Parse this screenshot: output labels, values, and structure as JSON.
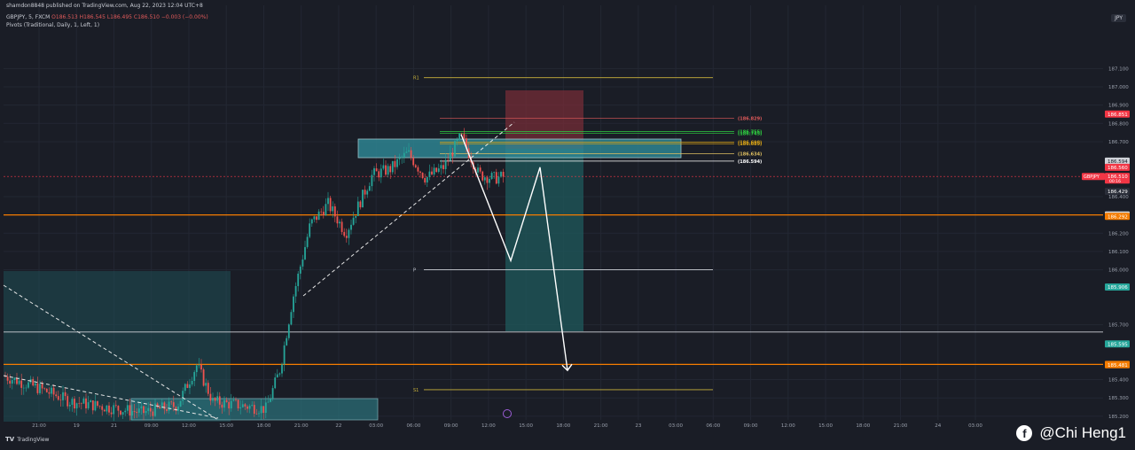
{
  "header": {
    "publisher_line": "shamdon8848 published on TradingView.com, Aug 22, 2023 12:04 UTC+8",
    "symbol_line": "GBPJPY, 5, FXCM",
    "ohlc_line": "O186.513 H186.545 L186.495 C186.510 −0.003 (−0.00%)",
    "indicator_line": "Pivots (Traditional, Daily, 1, Left, 1)",
    "currency_badge": "JPY"
  },
  "footer": {
    "brand": "TradingView",
    "logo": "TV"
  },
  "watermark": {
    "icon": "facebook-icon",
    "text": "@Chi Heng1"
  },
  "colors": {
    "background": "#1a1d26",
    "bull": "#26a69a",
    "bear": "#ef5350",
    "zone": "#1f4e55",
    "orange_line": "#f57c00",
    "pivot_yellow": "#c9b23a",
    "pivot_white": "#cfd2d8",
    "current_price": "#f23645"
  },
  "chart_data": {
    "type": "candlestick",
    "symbol": "GBPJPY",
    "timeframe": "5",
    "ylim": [
      185.18,
      187.3
    ],
    "price_axis_ticks": [
      187.1,
      187.0,
      186.9,
      186.8,
      186.7,
      186.4,
      186.2,
      186.1,
      186.0,
      185.7,
      185.4,
      185.3,
      185.2
    ],
    "price_labels": [
      {
        "value": 186.851,
        "text": "186.851",
        "color": "#f23645"
      },
      {
        "value": 186.594,
        "text": "186.594",
        "color": "#cfd2d8"
      },
      {
        "value": 186.56,
        "text": "186.560",
        "color": "#f23645"
      },
      {
        "value": 186.51,
        "text": "186.510",
        "color": "#f23645"
      },
      {
        "value": 186.429,
        "text": "186.429",
        "color": "#2a2e39"
      },
      {
        "value": 186.3,
        "text": "186.300",
        "color": "#cfd2d8"
      },
      {
        "value": 186.292,
        "text": "186.292",
        "color": "#f57c00"
      },
      {
        "value": 185.906,
        "text": "185.906",
        "color": "#26a69a"
      },
      {
        "value": 185.595,
        "text": "185.595",
        "color": "#26a69a"
      },
      {
        "value": 185.483,
        "text": "185.483",
        "color": "#f57c00"
      },
      {
        "value": 185.481,
        "text": "185.481",
        "color": "#f57c00"
      }
    ],
    "current_price_label": {
      "symbol": "GBPJPY",
      "price": "186.510",
      "countdown": "00:16"
    },
    "time_axis_ticks": [
      "21:00",
      "19",
      "21",
      "09:00",
      "12:00",
      "15:00",
      "18:00",
      "21:00",
      "22",
      "03:00",
      "06:00",
      "09:00",
      "12:00",
      "15:00",
      "18:00",
      "21:00",
      "23",
      "03:00",
      "06:00",
      "09:00",
      "12:00",
      "15:00",
      "18:00",
      "21:00",
      "24",
      "03:00"
    ],
    "pivots": [
      {
        "name": "R1",
        "value": 187.05,
        "color": "#c9b23a"
      },
      {
        "name": "P",
        "value": 186.0,
        "color": "#cfd2d8"
      },
      {
        "name": "S1",
        "value": 185.345,
        "color": "#c9b23a"
      }
    ],
    "level_labels": [
      {
        "value": 186.829,
        "text": "(186.829)",
        "color": "#e05a5a"
      },
      {
        "value": 186.755,
        "text": "(186.755)",
        "color": "#2ecc40"
      },
      {
        "value": 186.745,
        "text": "(186.745)",
        "color": "#2ecc40"
      },
      {
        "value": 186.698,
        "text": "(186.698)",
        "color": "#d4a017"
      },
      {
        "value": 186.689,
        "text": "(186.689)",
        "color": "#d4a017"
      },
      {
        "value": 186.634,
        "text": "(186.634)",
        "color": "#e0c060"
      },
      {
        "value": 186.594,
        "text": "(186.594)",
        "color": "#ffffff"
      }
    ],
    "horizontal_lines": [
      {
        "value": 186.3,
        "color": "#f57c00"
      },
      {
        "value": 185.483,
        "color": "#f57c00"
      },
      {
        "value": 185.66,
        "color": "#cfd2d8"
      },
      {
        "value": 186.51,
        "color": "#f23645"
      }
    ],
    "projection_path": [
      {
        "price": 186.74
      },
      {
        "price": 186.05
      },
      {
        "price": 186.56
      },
      {
        "price": 185.45
      }
    ]
  }
}
